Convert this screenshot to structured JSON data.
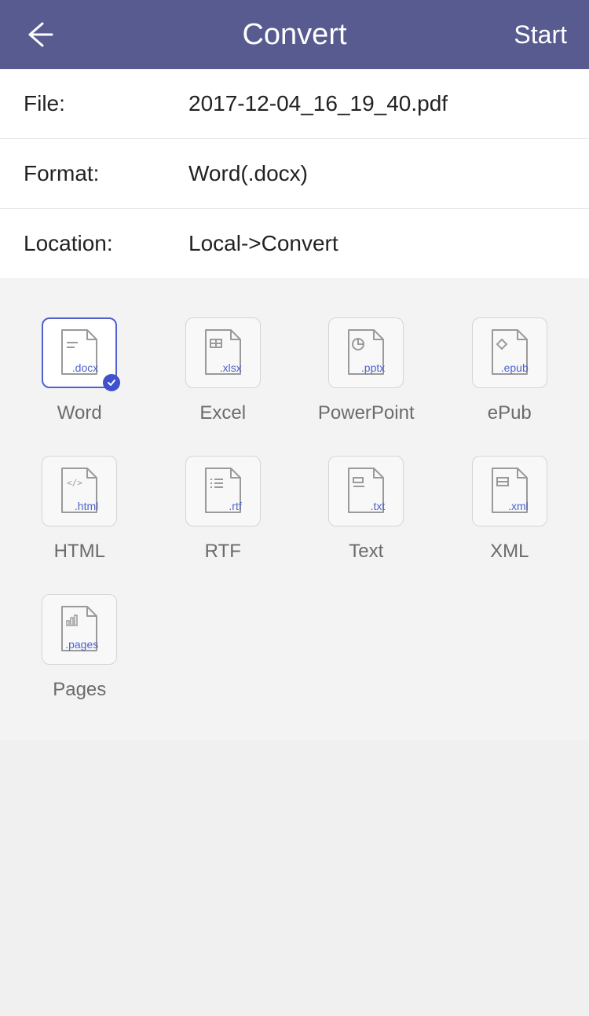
{
  "header": {
    "title": "Convert",
    "start_label": "Start"
  },
  "info": {
    "file_label": "File:",
    "file_value": "2017-12-04_16_19_40.pdf",
    "format_label": "Format:",
    "format_value": "Word(.docx)",
    "location_label": "Location:",
    "location_value": "Local->Convert"
  },
  "formats": [
    {
      "ext": ".docx",
      "label": "Word",
      "selected": true
    },
    {
      "ext": ".xlsx",
      "label": "Excel",
      "selected": false
    },
    {
      "ext": ".pptx",
      "label": "PowerPoint",
      "selected": false
    },
    {
      "ext": ".epub",
      "label": "ePub",
      "selected": false
    },
    {
      "ext": ".html",
      "label": "HTML",
      "selected": false
    },
    {
      "ext": ".rtf",
      "label": "RTF",
      "selected": false
    },
    {
      "ext": ".txt",
      "label": "Text",
      "selected": false
    },
    {
      "ext": ".xml",
      "label": "XML",
      "selected": false
    },
    {
      "ext": ".pages",
      "label": "Pages",
      "selected": false
    }
  ]
}
